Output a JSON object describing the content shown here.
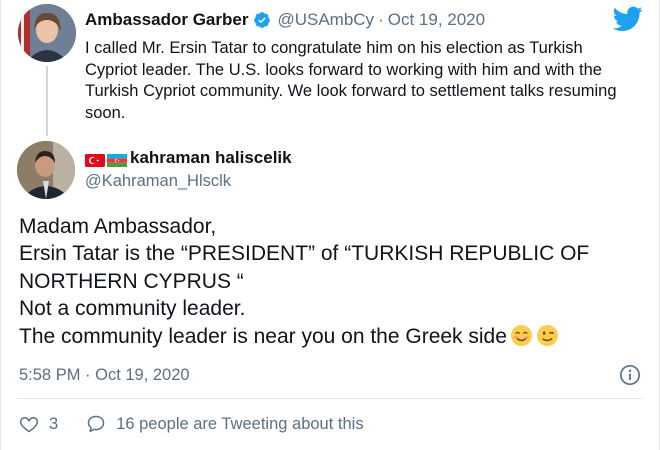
{
  "parent_tweet": {
    "name": "Ambassador Garber",
    "handle": "@USAmbCy",
    "separator": "·",
    "date": "Oct 19, 2020",
    "text": "I called Mr. Ersin Tatar to congratulate him on his election as Turkish Cypriot leader. The U.S. looks forward to working with him and with the Turkish Cypriot community.  We look forward to settlement talks resuming soon."
  },
  "reply": {
    "name": "kahraman haliscelik",
    "handle": "@Kahraman_Hlsclk",
    "lines": [
      "Madam Ambassador,",
      "Ersin Tatar is the “PRESIDENT” of “TURKISH REPUBLIC OF NORTHERN CYPRUS “",
      "Not a community leader.",
      "The community leader is near you on the Greek side"
    ],
    "timestamp": "5:58 PM · Oct 19, 2020"
  },
  "actions": {
    "likes": "3",
    "tweeting_about": "16 people are Tweeting about this"
  },
  "colors": {
    "twitter_blue": "#1da1f2",
    "secondary_text": "#5b7083",
    "divider": "#e1e8ed"
  },
  "icons": [
    "verified-badge-icon",
    "twitter-bird-icon",
    "turkey-flag-icon",
    "azerbaijan-flag-icon",
    "smiling-face-emoji",
    "winking-face-emoji",
    "info-icon",
    "heart-icon",
    "comment-icon"
  ]
}
